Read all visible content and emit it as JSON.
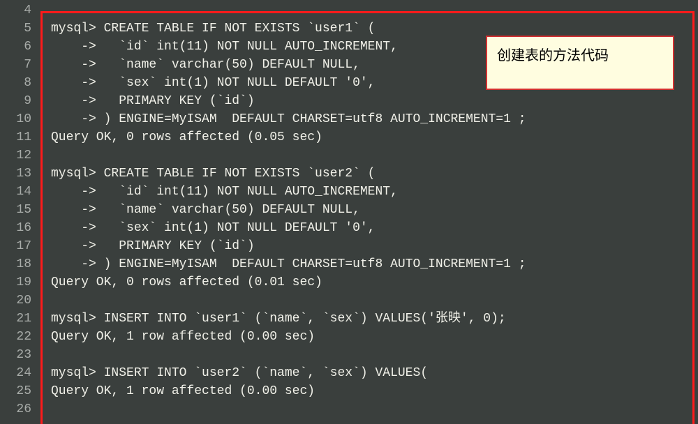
{
  "lines": [
    {
      "num": 4,
      "text": ""
    },
    {
      "num": 5,
      "text": "mysql> CREATE TABLE IF NOT EXISTS `user1` ("
    },
    {
      "num": 6,
      "text": "    ->   `id` int(11) NOT NULL AUTO_INCREMENT,"
    },
    {
      "num": 7,
      "text": "    ->   `name` varchar(50) DEFAULT NULL,"
    },
    {
      "num": 8,
      "text": "    ->   `sex` int(1) NOT NULL DEFAULT '0',"
    },
    {
      "num": 9,
      "text": "    ->   PRIMARY KEY (`id`)"
    },
    {
      "num": 10,
      "text": "    -> ) ENGINE=MyISAM  DEFAULT CHARSET=utf8 AUTO_INCREMENT=1 ;"
    },
    {
      "num": 11,
      "text": "Query OK, 0 rows affected (0.05 sec)"
    },
    {
      "num": 12,
      "text": ""
    },
    {
      "num": 13,
      "text": "mysql> CREATE TABLE IF NOT EXISTS `user2` ("
    },
    {
      "num": 14,
      "text": "    ->   `id` int(11) NOT NULL AUTO_INCREMENT,"
    },
    {
      "num": 15,
      "text": "    ->   `name` varchar(50) DEFAULT NULL,"
    },
    {
      "num": 16,
      "text": "    ->   `sex` int(1) NOT NULL DEFAULT '0',"
    },
    {
      "num": 17,
      "text": "    ->   PRIMARY KEY (`id`)"
    },
    {
      "num": 18,
      "text": "    -> ) ENGINE=MyISAM  DEFAULT CHARSET=utf8 AUTO_INCREMENT=1 ;"
    },
    {
      "num": 19,
      "text": "Query OK, 0 rows affected (0.01 sec)"
    },
    {
      "num": 20,
      "text": ""
    },
    {
      "num": 21,
      "text": "mysql> INSERT INTO `user1` (`name`, `sex`) VALUES('张映', 0);"
    },
    {
      "num": 22,
      "text": "Query OK, 1 row affected (0.00 sec)"
    },
    {
      "num": 23,
      "text": ""
    },
    {
      "num": 24,
      "text": "mysql> INSERT INTO `user2` (`name`, `sex`) VALUES("
    },
    {
      "num": 25,
      "text": "Query OK, 1 row affected (0.00 sec)"
    },
    {
      "num": 26,
      "text": ""
    }
  ],
  "annotation": {
    "text": "创建表的方法代码"
  }
}
